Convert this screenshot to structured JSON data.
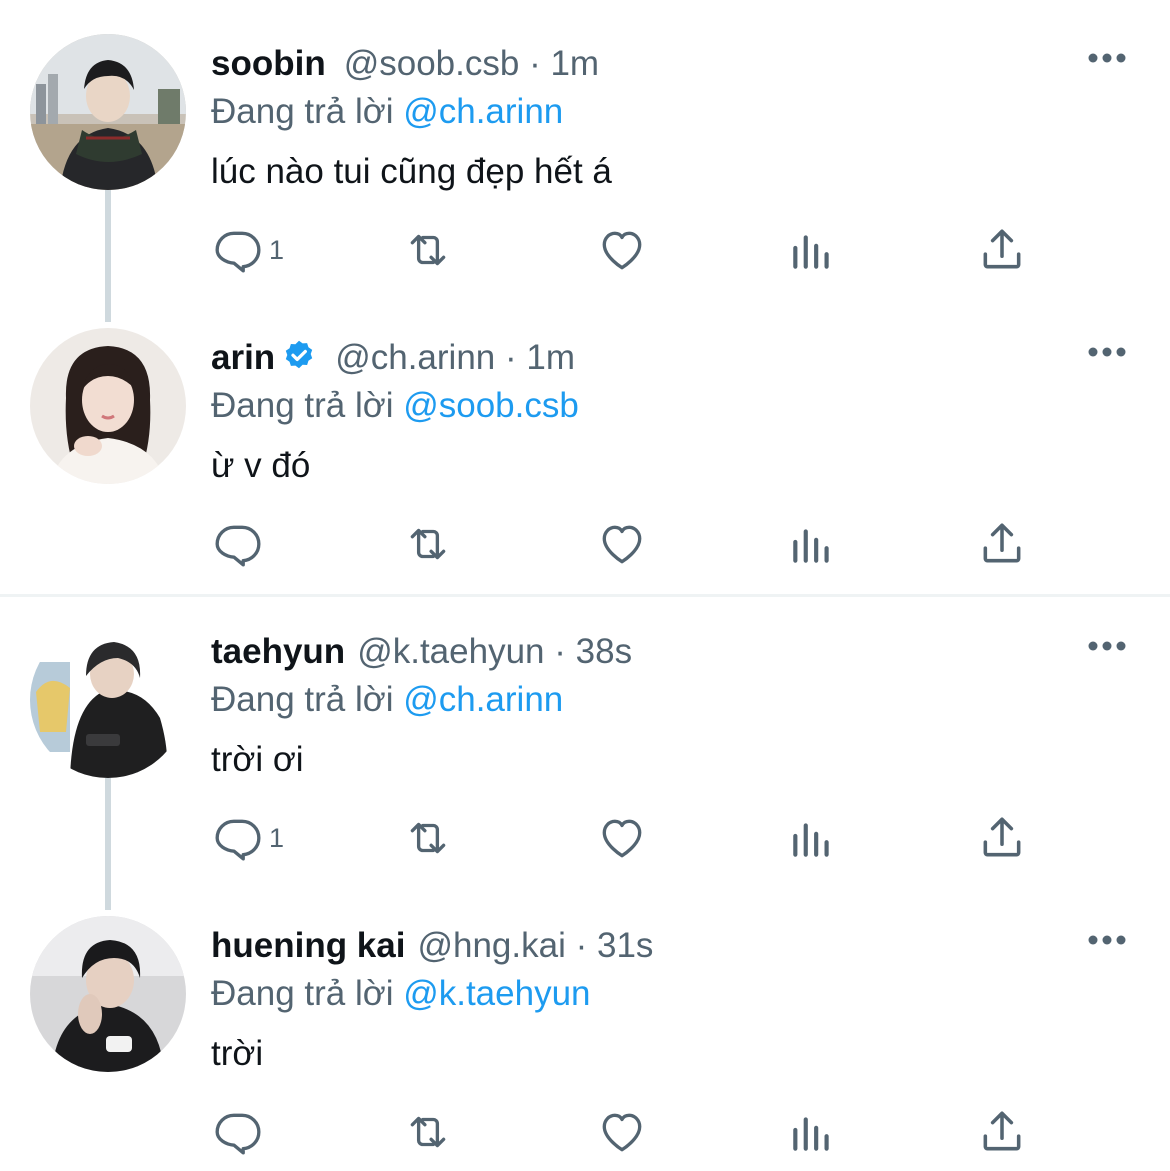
{
  "colors": {
    "accent": "#1d9bf0",
    "secondary_text": "#536471",
    "primary_text": "#0f1419",
    "thread_line": "#cfd9de"
  },
  "replying_prefix": "Đang trả lời",
  "tweets": [
    {
      "name": "soobin",
      "verified": false,
      "handle": "@soob.csb",
      "separator": "·",
      "time": "1m",
      "mention": "@ch.arinn",
      "text": "lúc nào tui cũng đẹp hết á",
      "reply_count": "1",
      "avatar_icon": "avatar-photo"
    },
    {
      "name": "arin",
      "verified": true,
      "handle": "@ch.arinn",
      "separator": "·",
      "time": "1m",
      "mention": "@soob.csb",
      "text": "ừ v đó",
      "reply_count": "",
      "avatar_icon": "avatar-photo"
    },
    {
      "name": "taehyun",
      "verified": false,
      "handle": "@k.taehyun",
      "separator": "·",
      "time": "38s",
      "mention": "@ch.arinn",
      "text": "trời ơi",
      "reply_count": "1",
      "avatar_icon": "avatar-photo"
    },
    {
      "name": "huening kai",
      "verified": false,
      "handle": "@hng.kai",
      "separator": "·",
      "time": "31s",
      "mention": "@k.taehyun",
      "text": "trời",
      "reply_count": "",
      "avatar_icon": "avatar-photo"
    }
  ],
  "action_icons": [
    "reply-icon",
    "retweet-icon",
    "like-icon",
    "analytics-icon",
    "share-icon"
  ]
}
